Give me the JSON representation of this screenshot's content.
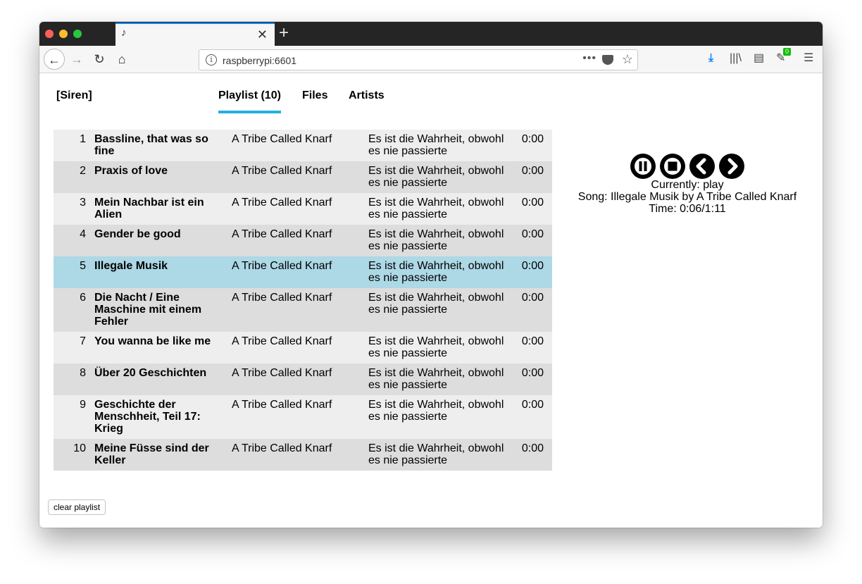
{
  "browser": {
    "tab_title": "",
    "tab_icon": "♪",
    "url": "raspberrypi:6601",
    "extension_badge": "0"
  },
  "app": {
    "brand": "[Siren]",
    "nav": {
      "playlist": "Playlist (10)",
      "files": "Files",
      "artists": "Artists"
    },
    "clear_label": "clear playlist"
  },
  "playlist": [
    {
      "num": "1",
      "title": "Bassline, that was so fine",
      "artist": "A Tribe Called Knarf",
      "album": "Es ist die Wahrheit, obwohl es nie passierte",
      "duration": "0:00"
    },
    {
      "num": "2",
      "title": "Praxis of love",
      "artist": "A Tribe Called Knarf",
      "album": "Es ist die Wahrheit, obwohl es nie passierte",
      "duration": "0:00"
    },
    {
      "num": "3",
      "title": "Mein Nachbar ist ein Alien",
      "artist": "A Tribe Called Knarf",
      "album": "Es ist die Wahrheit, obwohl es nie passierte",
      "duration": "0:00"
    },
    {
      "num": "4",
      "title": "Gender be good",
      "artist": "A Tribe Called Knarf",
      "album": "Es ist die Wahrheit, obwohl es nie passierte",
      "duration": "0:00"
    },
    {
      "num": "5",
      "title": "Illegale Musik",
      "artist": "A Tribe Called Knarf",
      "album": "Es ist die Wahrheit, obwohl es nie passierte",
      "duration": "0:00"
    },
    {
      "num": "6",
      "title": "Die Nacht / Eine Maschine mit einem Fehler",
      "artist": "A Tribe Called Knarf",
      "album": "Es ist die Wahrheit, obwohl es nie passierte",
      "duration": "0:00"
    },
    {
      "num": "7",
      "title": "You wanna be like me",
      "artist": "A Tribe Called Knarf",
      "album": "Es ist die Wahrheit, obwohl es nie passierte",
      "duration": "0:00"
    },
    {
      "num": "8",
      "title": "Über 20 Geschichten",
      "artist": "A Tribe Called Knarf",
      "album": "Es ist die Wahrheit, obwohl es nie passierte",
      "duration": "0:00"
    },
    {
      "num": "9",
      "title": "Geschichte der Menschheit, Teil 17: Krieg",
      "artist": "A Tribe Called Knarf",
      "album": "Es ist die Wahrheit, obwohl es nie passierte",
      "duration": "0:00"
    },
    {
      "num": "10",
      "title": "Meine Füsse sind der Keller",
      "artist": "A Tribe Called Knarf",
      "album": "Es ist die Wahrheit, obwohl es nie passierte",
      "duration": "0:00"
    }
  ],
  "current_track_num": "5",
  "player": {
    "state_line": "Currently: play",
    "song_line": "Song: Illegale Musik by A Tribe Called Knarf",
    "time_line": "Time: 0:06/1:11"
  },
  "colors": {
    "tab_accent": "#0a84ff",
    "nav_active_underline": "#22b1e3",
    "row_current": "#add8e6",
    "row_odd": "#eeeeee",
    "row_even": "#dddddd"
  }
}
